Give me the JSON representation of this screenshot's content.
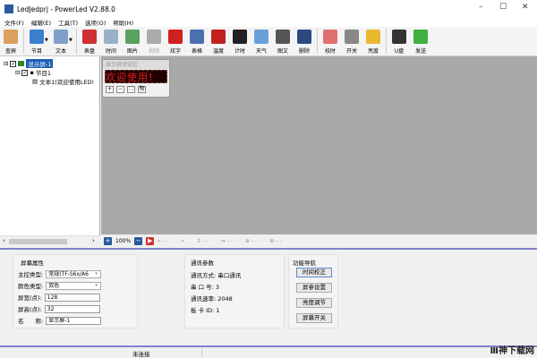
{
  "window": {
    "title": "LedJedprj - PowerLed V2.88.0",
    "minimize": "–",
    "maximize": "☐",
    "close": "✕"
  },
  "menu": [
    "文件(F)",
    "编辑(E)",
    "工具(T)",
    "选项(O)",
    "帮助(H)"
  ],
  "toolbar": [
    {
      "label": "查屏",
      "icon": "magnifier-icon",
      "color": "#d9a060"
    },
    {
      "label": "节目",
      "icon": "program-icon",
      "color": "#3a7fd0",
      "dropdown": true
    },
    {
      "label": "文本",
      "icon": "text-icon",
      "color": "#7fa0c8",
      "dropdown": true
    },
    {
      "label": "表盘",
      "icon": "clock-icon",
      "color": "#d03030"
    },
    {
      "label": "时间",
      "icon": "calendar-icon",
      "color": "#9ab0c8"
    },
    {
      "label": "图片",
      "icon": "picture-icon",
      "color": "#5aa060"
    },
    {
      "label": "视频",
      "icon": "video-icon",
      "color": "#aaaaaa",
      "disabled": true
    },
    {
      "label": "炫字",
      "icon": "flash-text-icon",
      "color": "#d02020"
    },
    {
      "label": "表格",
      "icon": "table-icon",
      "color": "#4a70b0"
    },
    {
      "label": "温度",
      "icon": "thermometer-icon",
      "color": "#c02020"
    },
    {
      "label": "计时",
      "icon": "timer-icon",
      "color": "#222222"
    },
    {
      "label": "天气",
      "icon": "weather-icon",
      "color": "#6aa0d8"
    },
    {
      "label": "图文",
      "icon": "grid-icon",
      "color": "#555555"
    },
    {
      "label": "删除",
      "icon": "delete-icon",
      "color": "#2a4a80"
    },
    {
      "label": "校时",
      "icon": "alarm-clock-icon",
      "color": "#e07070"
    },
    {
      "label": "开关",
      "icon": "power-icon",
      "color": "#888888"
    },
    {
      "label": "亮度",
      "icon": "bulb-icon",
      "color": "#e8b830"
    },
    {
      "label": "U盘",
      "icon": "usb-icon",
      "color": "#333333"
    },
    {
      "label": "发送",
      "icon": "send-arrow-icon",
      "color": "#40b040"
    }
  ],
  "tree": {
    "screen": "显示屏-1",
    "program": "节目1",
    "text": "文本1(欢迎使用LED!"
  },
  "preview": {
    "title": "显示屏预览区",
    "led_text": "欢迎使用!",
    "buttons": [
      "+",
      "−",
      "⛶",
      "物"
    ]
  },
  "zoombar": {
    "zoom": "100%",
    "dashes": "- -"
  },
  "screen_props": {
    "title": "屏幕属性",
    "controller_label": "主控类型:",
    "controller": "常规(TF-S6x/A6",
    "color_label": "颜色类型:",
    "color": "双色",
    "width_label": "屏宽(点):",
    "width": "128",
    "height_label": "屏高(点):",
    "height": "32",
    "name_label": "名　　称:",
    "name": "显示屏-1"
  },
  "comm": {
    "title": "通讯参数",
    "mode": "通讯方式: 串口通讯",
    "port": "串 口 号: 3",
    "baud": "通讯速率: 2048",
    "card": "板 卡 ID: 1"
  },
  "nav": {
    "title": "功能导航",
    "buttons": [
      "时间校正",
      "屏参设置",
      "亮度调节",
      "屏幕开关"
    ]
  },
  "status": {
    "connection": "未连接"
  },
  "watermark": "Ⅲ神下载网"
}
